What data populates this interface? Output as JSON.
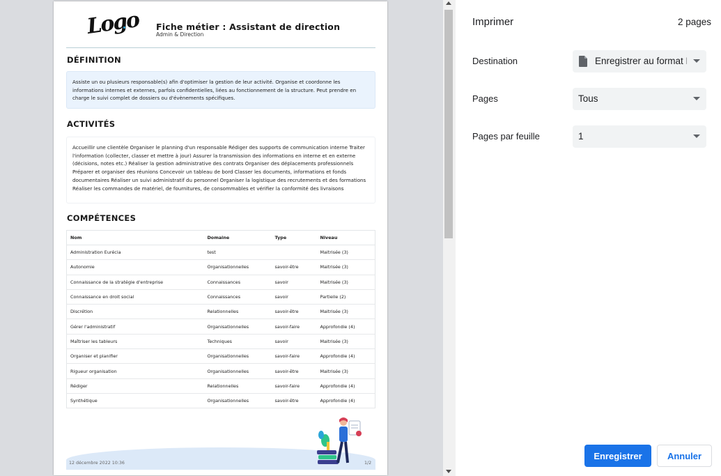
{
  "document": {
    "logo_text": "Logo",
    "title": "Fiche métier : Assistant de direction",
    "subtitle": "Admin & Direction",
    "definition_heading": "DÉFINITION",
    "definition_text": "Assiste un ou plusieurs responsable(s) afin d'optimiser la gestion de leur activité. Organise et coordonne les informations internes et externes, parfois confidentielles, liées au fonctionnement de la structure. Peut prendre en charge le suivi complet de dossiers ou d'évènements spécifiques.",
    "activities_heading": "ACTIVITÉS",
    "activities_text": "Accueillir une clientèle Organiser le planning d'un responsable Rédiger des supports de communication interne Traiter l'information (collecter, classer et mettre à jour) Assurer la transmission des informations en interne et en externe (décisions, notes etc.) Réaliser la gestion administrative des contrats Organiser des déplacements professionnels Préparer et organiser des réunions Concevoir un tableau de bord Classer les documents, informations et fonds documentaires Réaliser un suivi administratif du personnel Organiser la logistique des recrutements et des formations Réaliser les commandes de matériel, de fournitures, de consommables et vérifier la conformité des livraisons",
    "competences_heading": "COMPÉTENCES",
    "table_headers": [
      "Nom",
      "Domaine",
      "Type",
      "Niveau"
    ],
    "table_rows": [
      [
        "Administration Eurécia",
        "test",
        "",
        "Maitrisée (3)"
      ],
      [
        "Autonomie",
        "Organisationnelles",
        "savoir-être",
        "Maitrisée (3)"
      ],
      [
        "Connaissance de la stratégie d'entreprise",
        "Connaissances",
        "savoir",
        "Maitrisée (3)"
      ],
      [
        "Connaissance en droit social",
        "Connaissances",
        "savoir",
        "Partielle (2)"
      ],
      [
        "Discrétion",
        "Relationnelles",
        "savoir-être",
        "Maitrisée (3)"
      ],
      [
        "Gérer l'administratif",
        "Organisationnelles",
        "savoir-faire",
        "Approfondie (4)"
      ],
      [
        "Maîtriser les tableurs",
        "Techniques",
        "savoir",
        "Maitrisée (3)"
      ],
      [
        "Organiser et planifier",
        "Organisationnelles",
        "savoir-faire",
        "Approfondie (4)"
      ],
      [
        "Rigueur organisation",
        "Organisationnelles",
        "savoir-être",
        "Maitrisée (3)"
      ],
      [
        "Rédiger",
        "Relationnelles",
        "savoir-faire",
        "Approfondie (4)"
      ],
      [
        "Synthétique",
        "Organisationnelles",
        "savoir-être",
        "Approfondie (4)"
      ]
    ],
    "footer_date": "12 décembre 2022 10:36",
    "footer_page": "1/2"
  },
  "panel": {
    "title": "Imprimer",
    "page_count": "2 pages",
    "destination_label": "Destination",
    "destination_value": "Enregistrer au format PDF",
    "pages_label": "Pages",
    "pages_value": "Tous",
    "per_sheet_label": "Pages par feuille",
    "per_sheet_value": "1",
    "save_label": "Enregistrer",
    "cancel_label": "Annuler"
  },
  "colors": {
    "accent": "#1a73e8",
    "preview_bg": "#dadce0",
    "definition_bg": "#eaf3fd"
  },
  "icons": {
    "destination": "file-icon",
    "dropdown": "chevron-down-icon"
  }
}
